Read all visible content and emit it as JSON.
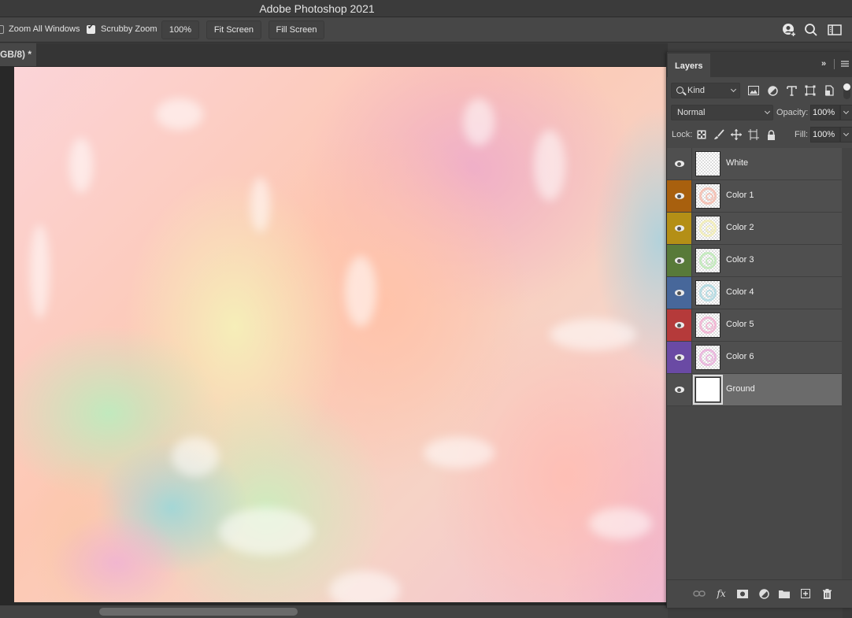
{
  "app": {
    "title": "Adobe Photoshop 2021"
  },
  "options_bar": {
    "zoom_all_windows": {
      "label": "Zoom All Windows",
      "checked": false
    },
    "scrubby_zoom": {
      "label": "Scrubby Zoom",
      "checked": true
    },
    "zoom_100": "100%",
    "fit_screen": "Fit Screen",
    "fill_screen": "Fill Screen",
    "icons": [
      "share-user-icon",
      "search-icon",
      "workspace-icon"
    ]
  },
  "document": {
    "tab_label": "GB/8) *"
  },
  "layers_panel": {
    "tab_label": "Layers",
    "collapse_label": "»",
    "filter": {
      "kind_label": "Kind",
      "icons": [
        "pixel-filter-icon",
        "adjustment-filter-icon",
        "type-filter-icon",
        "shape-filter-icon",
        "smart-object-filter-icon"
      ]
    },
    "blend_mode": "Normal",
    "opacity_label": "Opacity:",
    "opacity_value": "100%",
    "lock_label": "Lock:",
    "lock_icons": [
      "lock-transparent-icon",
      "lock-image-icon",
      "lock-position-icon",
      "artboard-lock-icon",
      "lock-all-icon"
    ],
    "fill_label": "Fill:",
    "fill_value": "100%",
    "layers": [
      {
        "name": "White",
        "color_label": "#4f4f4f",
        "thumb": "#f4f4f4",
        "visible": true,
        "selected": false
      },
      {
        "name": "Color 1",
        "color_label": "#a8600e",
        "thumb": "#f6b5a5",
        "visible": true,
        "selected": false
      },
      {
        "name": "Color 2",
        "color_label": "#b48f16",
        "thumb": "#f3eeae",
        "visible": true,
        "selected": false
      },
      {
        "name": "Color 3",
        "color_label": "#587a39",
        "thumb": "#b8e8b0",
        "visible": true,
        "selected": false
      },
      {
        "name": "Color 4",
        "color_label": "#47679a",
        "thumb": "#a5d6df",
        "visible": true,
        "selected": false
      },
      {
        "name": "Color 5",
        "color_label": "#b53a3a",
        "thumb": "#f2a8cc",
        "visible": true,
        "selected": false
      },
      {
        "name": "Color 6",
        "color_label": "#6a4aa4",
        "thumb": "#e8a8d8",
        "visible": true,
        "selected": false
      },
      {
        "name": "Ground",
        "color_label": "#4f4f4f",
        "thumb": "#ffffff",
        "visible": true,
        "selected": true
      }
    ],
    "footer_icons": [
      "link-layers-icon",
      "fx-icon",
      "add-mask-icon",
      "adjustment-layer-icon",
      "group-folder-icon",
      "new-layer-icon",
      "trash-icon"
    ]
  }
}
